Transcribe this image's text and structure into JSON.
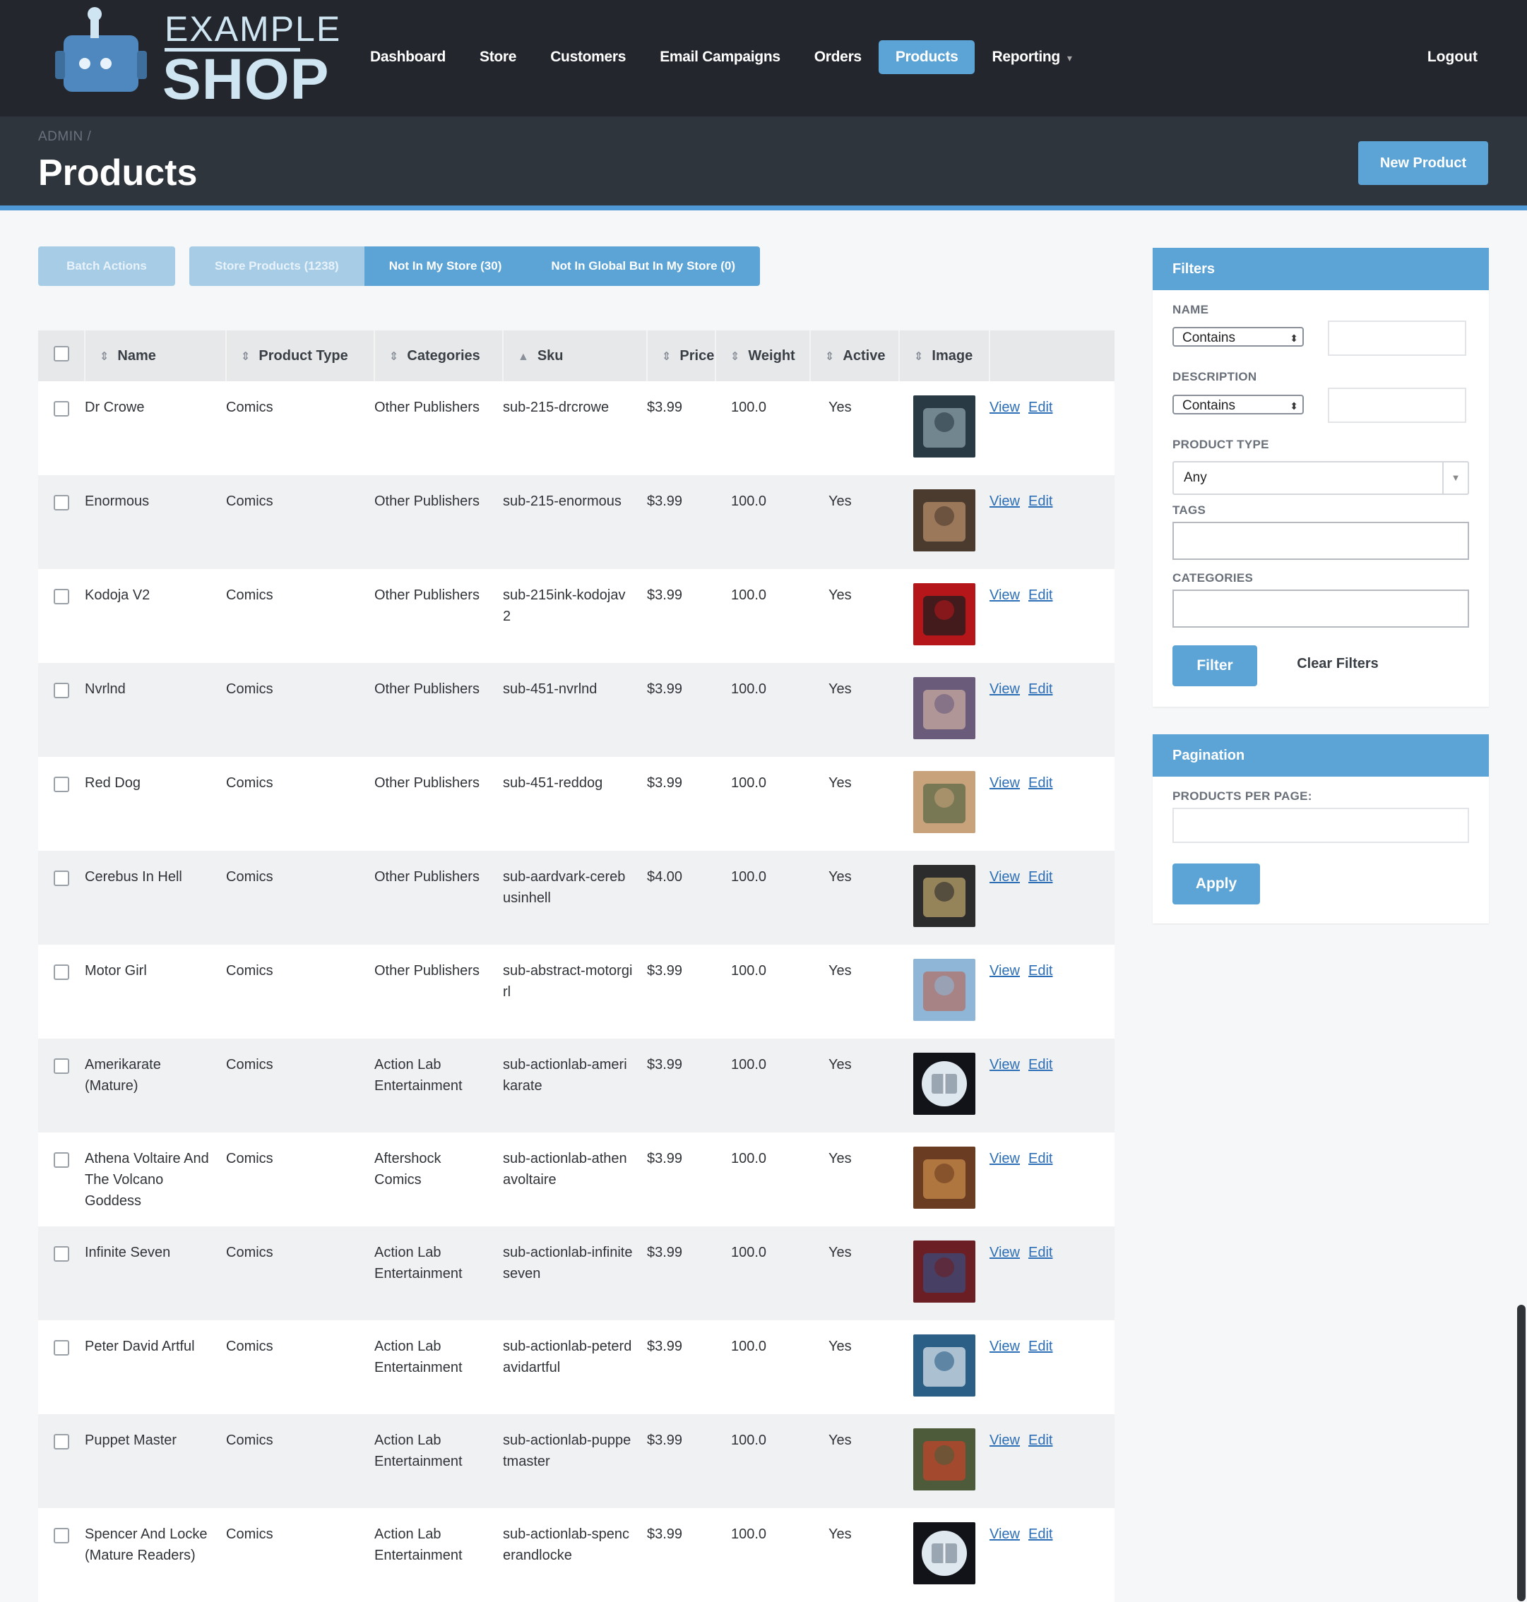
{
  "brand": {
    "line1": "EXAMPLE",
    "line2": "SHOP"
  },
  "nav": {
    "items": [
      "Dashboard",
      "Store",
      "Customers",
      "Email Campaigns",
      "Orders",
      "Products",
      "Reporting"
    ],
    "active": "Products",
    "logout": "Logout"
  },
  "header": {
    "breadcrumb": "ADMIN /",
    "title": "Products",
    "new_button": "New Product"
  },
  "tabs": {
    "batch": "Batch Actions",
    "items": [
      "Store Products (1238)",
      "Not In My Store (30)",
      "Not In Global But In My Store (0)"
    ]
  },
  "table": {
    "columns": [
      "Name",
      "Product Type",
      "Categories",
      "Sku",
      "Price",
      "Weight",
      "Active",
      "Image"
    ],
    "view_label": "View",
    "edit_label": "Edit",
    "rows": [
      {
        "name": "Dr Crowe",
        "type": "Comics",
        "category": "Other Publishers",
        "sku": "sub-215-drcrowe",
        "price": "$3.99",
        "weight": "100.0",
        "active": "Yes"
      },
      {
        "name": "Enormous",
        "type": "Comics",
        "category": "Other Publishers",
        "sku": "sub-215-enormous",
        "price": "$3.99",
        "weight": "100.0",
        "active": "Yes"
      },
      {
        "name": "Kodoja V2",
        "type": "Comics",
        "category": "Other Publishers",
        "sku": "sub-215ink-kodojav2",
        "price": "$3.99",
        "weight": "100.0",
        "active": "Yes"
      },
      {
        "name": "Nvrlnd",
        "type": "Comics",
        "category": "Other Publishers",
        "sku": "sub-451-nvrlnd",
        "price": "$3.99",
        "weight": "100.0",
        "active": "Yes"
      },
      {
        "name": "Red Dog",
        "type": "Comics",
        "category": "Other Publishers",
        "sku": "sub-451-reddog",
        "price": "$3.99",
        "weight": "100.0",
        "active": "Yes"
      },
      {
        "name": "Cerebus In Hell",
        "type": "Comics",
        "category": "Other Publishers",
        "sku": "sub-aardvark-cerebusinhell",
        "price": "$4.00",
        "weight": "100.0",
        "active": "Yes"
      },
      {
        "name": "Motor Girl",
        "type": "Comics",
        "category": "Other Publishers",
        "sku": "sub-abstract-motorgirl",
        "price": "$3.99",
        "weight": "100.0",
        "active": "Yes"
      },
      {
        "name": "Amerikarate (Mature)",
        "type": "Comics",
        "category": "Action Lab Entertainment",
        "sku": "sub-actionlab-amerikarate",
        "price": "$3.99",
        "weight": "100.0",
        "active": "Yes"
      },
      {
        "name": "Athena Voltaire And The Volcano Goddess",
        "type": "Comics",
        "category": "Aftershock Comics",
        "sku": "sub-actionlab-athenavoltaire",
        "price": "$3.99",
        "weight": "100.0",
        "active": "Yes"
      },
      {
        "name": "Infinite Seven",
        "type": "Comics",
        "category": "Action Lab Entertainment",
        "sku": "sub-actionlab-infiniteseven",
        "price": "$3.99",
        "weight": "100.0",
        "active": "Yes"
      },
      {
        "name": "Peter David Artful",
        "type": "Comics",
        "category": "Action Lab Entertainment",
        "sku": "sub-actionlab-peterdavidartful",
        "price": "$3.99",
        "weight": "100.0",
        "active": "Yes"
      },
      {
        "name": "Puppet Master",
        "type": "Comics",
        "category": "Action Lab Entertainment",
        "sku": "sub-actionlab-puppetmaster",
        "price": "$3.99",
        "weight": "100.0",
        "active": "Yes"
      },
      {
        "name": "Spencer And Locke (Mature Readers)",
        "type": "Comics",
        "category": "Action Lab Entertainment",
        "sku": "sub-actionlab-spencerandlocke",
        "price": "$3.99",
        "weight": "100.0",
        "active": "Yes"
      }
    ]
  },
  "filters": {
    "title": "Filters",
    "name_label": "NAME",
    "name_mode": "Contains",
    "description_label": "DESCRIPTION",
    "description_mode": "Contains",
    "product_type_label": "PRODUCT TYPE",
    "product_type_value": "Any",
    "tags_label": "TAGS",
    "categories_label": "CATEGORIES",
    "filter_button": "Filter",
    "clear_button": "Clear Filters"
  },
  "pagination": {
    "title": "Pagination",
    "per_page_label": "PRODUCTS PER PAGE:",
    "apply_button": "Apply"
  },
  "colors": {
    "accent": "#5ca3d6",
    "topbar": "#23272d",
    "header": "#2f353d",
    "link": "#2c6fb6"
  }
}
